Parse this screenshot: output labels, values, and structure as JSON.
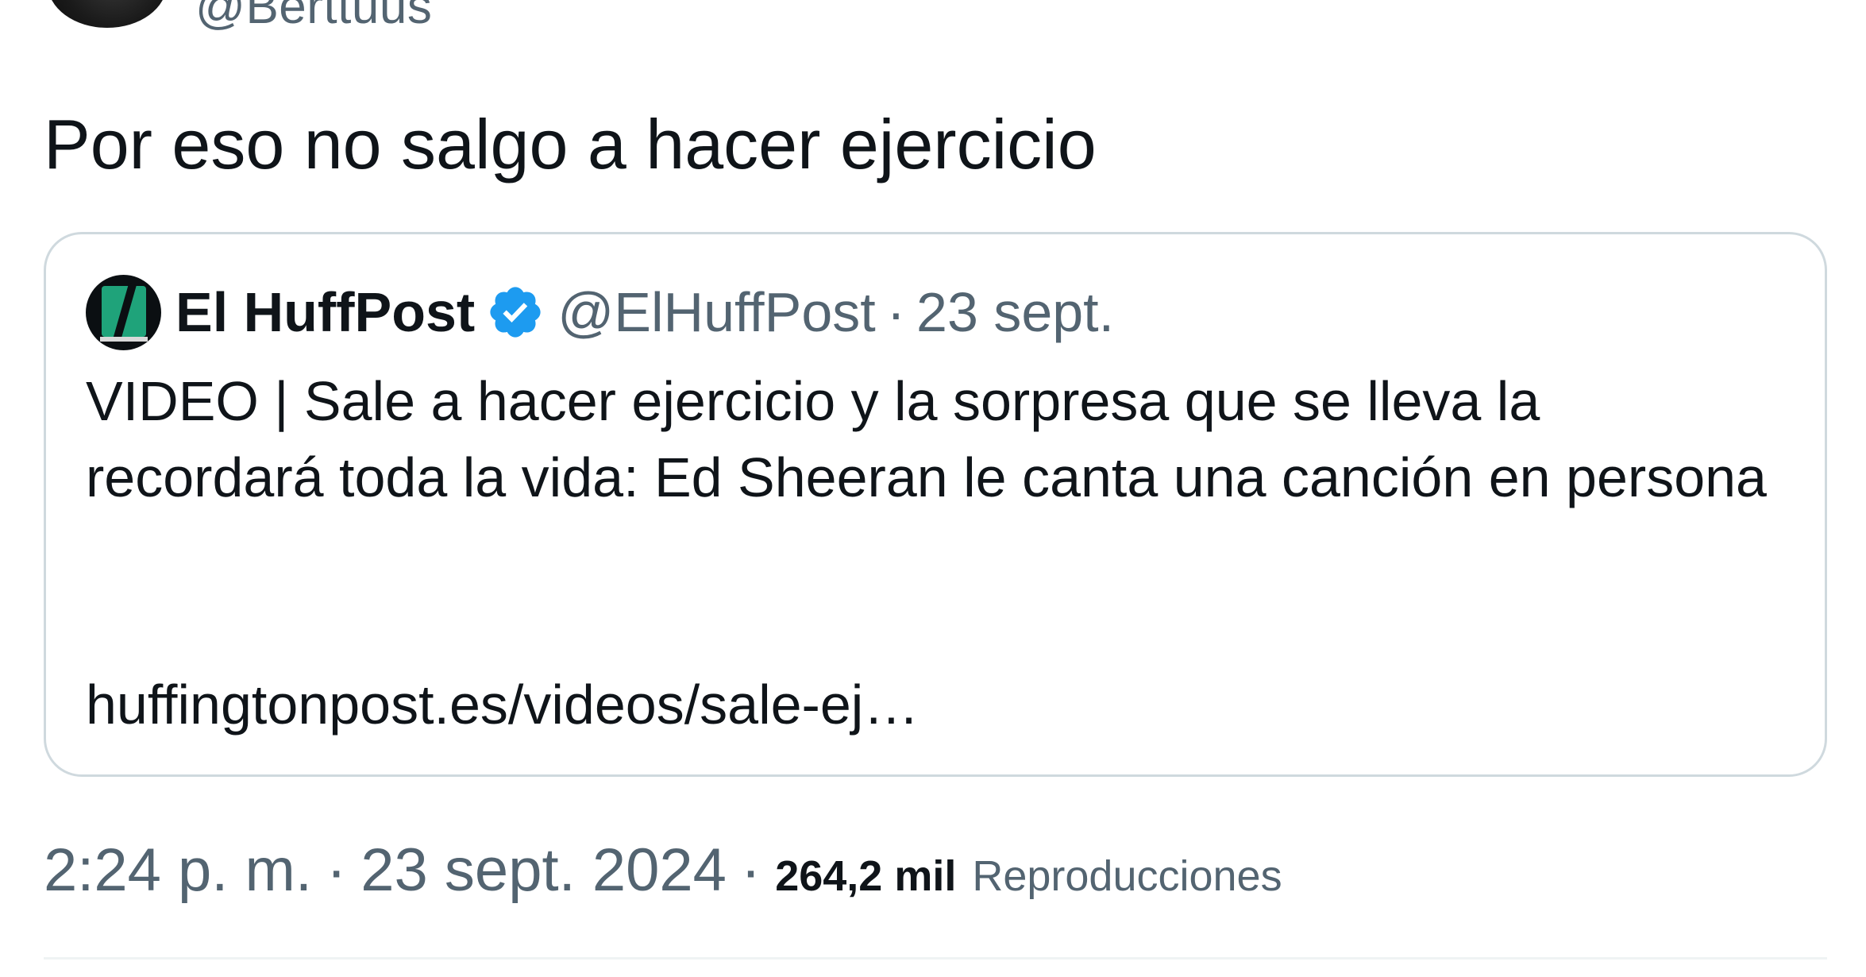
{
  "author": {
    "handle": "@Berttuus"
  },
  "tweet": {
    "text": "Por eso no salgo a hacer ejercicio"
  },
  "quoted_tweet": {
    "name": "El HuffPost",
    "handle": "@ElHuffPost",
    "separator": "·",
    "date": "23 sept.",
    "text": "VIDEO | Sale a hacer ejercicio y la sorpresa que se lleva la recordará toda la vida: Ed Sheeran le canta una canción en persona",
    "link": "huffingtonpost.es/videos/sale-ej…",
    "verified_icon": "verified-badge-icon",
    "verified_color": "#1d9bf0",
    "avatar_accent": "#1fa37a"
  },
  "meta": {
    "time": "2:24 p. m.",
    "separator": "·",
    "date": "23 sept. 2024",
    "views_count": "264,2 mil",
    "views_label": "Reproducciones"
  }
}
